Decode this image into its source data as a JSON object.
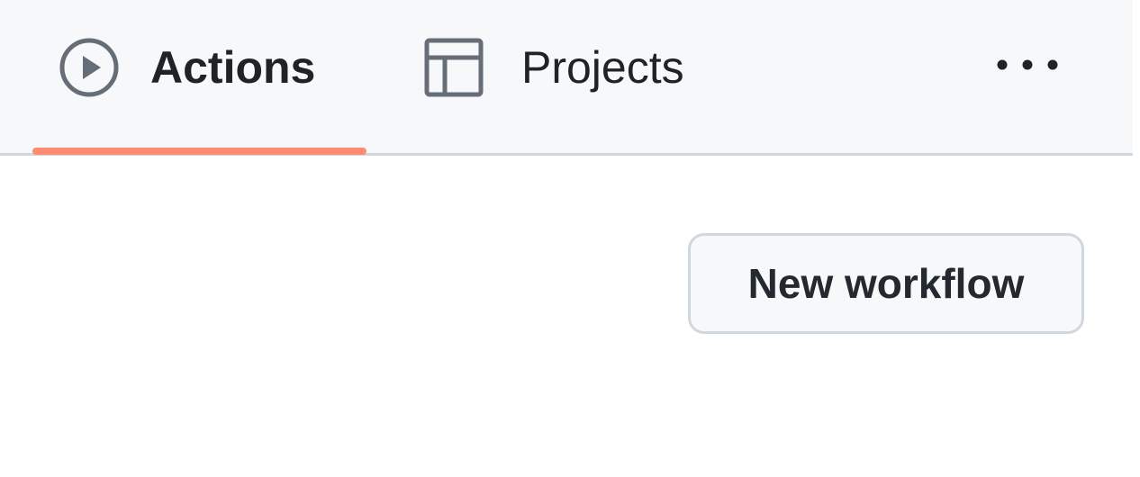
{
  "tabs": {
    "actions": {
      "label": "Actions",
      "icon": "play-icon",
      "selected": true
    },
    "projects": {
      "label": "Projects",
      "icon": "table-icon",
      "selected": false
    }
  },
  "more_menu": {
    "icon": "more-horizontal-icon"
  },
  "content": {
    "new_workflow_label": "New workflow"
  },
  "colors": {
    "header_background": "#f6f8fa",
    "active_underline": "#fd8c73",
    "text": "#1f2328",
    "icon": "#656d76",
    "border": "#d0d7de"
  }
}
